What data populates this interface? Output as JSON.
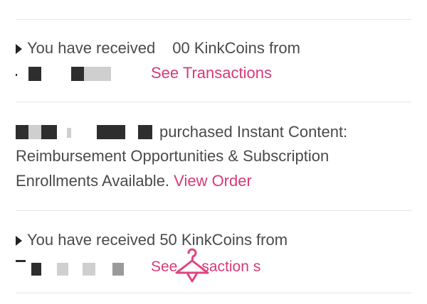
{
  "feed": {
    "items": [
      {
        "type": "coins",
        "text_before": "You have received",
        "amount_fragment": "00",
        "text_after": "KinkCoins from",
        "link": "See Transactions"
      },
      {
        "type": "purchase",
        "line1": "purchased Instant Content:",
        "line2": "Reimbursement Opportunities & Subscription",
        "line3": "Enrollments Available.",
        "link": "View Order"
      },
      {
        "type": "coins",
        "text": "You have received 50 KinkCoins from",
        "link_fragment_a": "See",
        "link_fragment_b": "saction",
        "link_fragment_c": "s"
      }
    ]
  },
  "colors": {
    "link": "#d63a78",
    "text": "#4a4a4a",
    "divider": "#e6e6e6",
    "redaction": "#2e2e2e"
  },
  "icons": [
    "triangle-bullet-icon",
    "hanger-watermark-icon"
  ]
}
